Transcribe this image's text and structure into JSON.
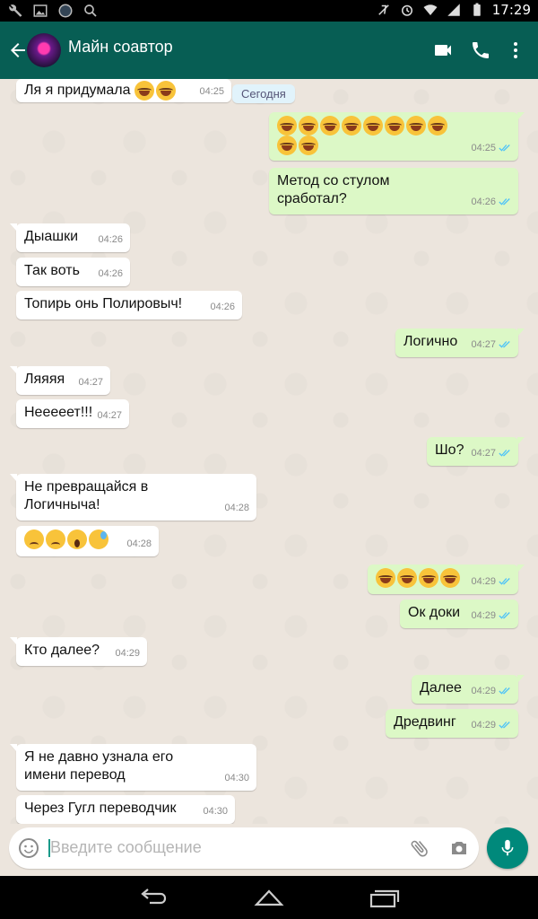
{
  "statusbar": {
    "time": "17:29"
  },
  "appbar": {
    "title": "Майн соавтор",
    "icons": [
      "back-arrow-icon",
      "video-call-icon",
      "phone-icon",
      "more-vert-icon"
    ]
  },
  "chat": {
    "day_label": "Сегодня",
    "messages": [
      {
        "side": "in",
        "text": "Ля я придумала",
        "emoji": [
          "laugh",
          "laugh"
        ],
        "time": "04:25"
      },
      {
        "side": "out",
        "emoji_row1": [
          "laugh",
          "laugh",
          "laugh",
          "laugh",
          "laugh",
          "laugh",
          "laugh",
          "laugh"
        ],
        "emoji_row2": [
          "laugh",
          "laugh"
        ],
        "time": "04:25"
      },
      {
        "side": "out",
        "text": "Метод со стулом сработал?",
        "time": "04:26"
      },
      {
        "side": "in",
        "text": "Дыашки",
        "time": "04:26"
      },
      {
        "side": "in",
        "text": "Так воть",
        "time": "04:26"
      },
      {
        "side": "in",
        "text": "Топирь онь Полировыч!",
        "time": "04:26"
      },
      {
        "side": "out",
        "text": "Логично",
        "time": "04:27"
      },
      {
        "side": "in",
        "text": "Ляяяя",
        "time": "04:27"
      },
      {
        "side": "in",
        "text": "Нееееет!!!",
        "time": "04:27"
      },
      {
        "side": "out",
        "text": "Шо?",
        "time": "04:27"
      },
      {
        "side": "in",
        "text": "Не превращайся в Логичныча!",
        "time": "04:28"
      },
      {
        "side": "in",
        "emoji": [
          "sad",
          "sad",
          "scream",
          "tear"
        ],
        "time": "04:28"
      },
      {
        "side": "out",
        "emoji": [
          "laugh",
          "laugh",
          "laugh",
          "laugh"
        ],
        "time": "04:29"
      },
      {
        "side": "out",
        "text": "Ок доки",
        "time": "04:29"
      },
      {
        "side": "in",
        "text": "Кто далее?",
        "time": "04:29"
      },
      {
        "side": "out",
        "text": "Далее",
        "time": "04:29"
      },
      {
        "side": "out",
        "text": "Дредвинг",
        "time": "04:29"
      },
      {
        "side": "in",
        "text": "Я не давно узнала его имени перевод",
        "time": "04:30"
      },
      {
        "side": "in",
        "text": "Через Гугл переводчик",
        "time": "04:30"
      }
    ]
  },
  "input": {
    "placeholder": "Введите сообщение"
  },
  "colors": {
    "appbar": "#075e54",
    "outgoing": "#dcf8c6",
    "incoming": "#ffffff",
    "accent": "#00897b",
    "read_ticks": "#4fc3f7"
  }
}
